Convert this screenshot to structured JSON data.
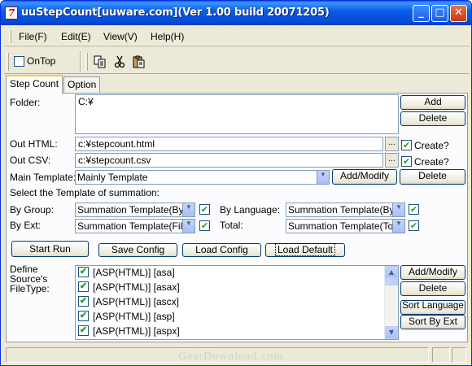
{
  "window": {
    "title": "uuStepCount[uuware.com](Ver 1.00 build 20071205)",
    "app_icon_glyph": "7",
    "minimize_glyph": "_",
    "maximize_glyph": "□",
    "close_glyph": "✕"
  },
  "menu": [
    {
      "label": "File(F)"
    },
    {
      "label": "Edit(E)"
    },
    {
      "label": "View(V)"
    },
    {
      "label": "Help(H)"
    }
  ],
  "toolbar": {
    "ontop_label": "OnTop",
    "ontop_checked": false,
    "icons": [
      "copy-icon",
      "cut-icon",
      "paste-icon"
    ]
  },
  "tabs": [
    {
      "label": "Step Count",
      "active": true
    },
    {
      "label": "Option",
      "active": false
    }
  ],
  "form": {
    "folder_label": "Folder:",
    "folder_value": "C:¥",
    "add_label": "Add",
    "delete_label": "Delete",
    "out_html_label": "Out HTML:",
    "out_html_value": "c:¥stepcount.html",
    "out_csv_label": "Out CSV:",
    "out_csv_value": "c:¥stepcount.csv",
    "browse_label": "...",
    "create_label": "Create?",
    "create_html_checked": true,
    "create_csv_checked": true,
    "main_template_label": "Main Template:",
    "main_template_value": "Mainly Template",
    "add_modify_label": "Add/Modify",
    "main_delete_label": "Delete",
    "select_template_label": "Select the Template of summation:",
    "by_group_label": "By Group:",
    "by_group_value": "Summation Template(By",
    "by_language_label": "By Language:",
    "by_language_value": "Summation Template(By",
    "by_ext_label": "By Ext:",
    "by_ext_value": "Summation Template(File",
    "total_label": "Total:",
    "total_value": "Summation Template(Tot",
    "start_run_label": "Start Run",
    "save_config_label": "Save Config",
    "load_config_label": "Load Config",
    "load_default_label": "Load Default",
    "define_label": "Define\nSource's\nFileType:",
    "filetypes": [
      "[ASP(HTML)] [asa]",
      "[ASP(HTML)] [asax]",
      "[ASP(HTML)] [ascx]",
      "[ASP(HTML)] [asp]",
      "[ASP(HTML)] [aspx]"
    ],
    "ft_add_modify_label": "Add/Modify",
    "ft_delete_label": "Delete",
    "sort_language_label": "Sort Language",
    "sort_by_ext_label": "Sort By Ext"
  },
  "watermark": "GearDownload.com"
}
